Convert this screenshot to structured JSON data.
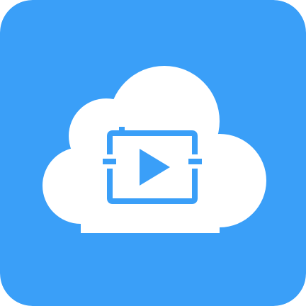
{
  "app_icon": {
    "name": "cloud-video-app-icon",
    "icons": [
      "cloud-icon",
      "video-frame-icon",
      "play-icon"
    ],
    "colors": {
      "background": "#3a9ff8",
      "cloud": "#ffffff",
      "accent": "#3a9ff8"
    }
  }
}
